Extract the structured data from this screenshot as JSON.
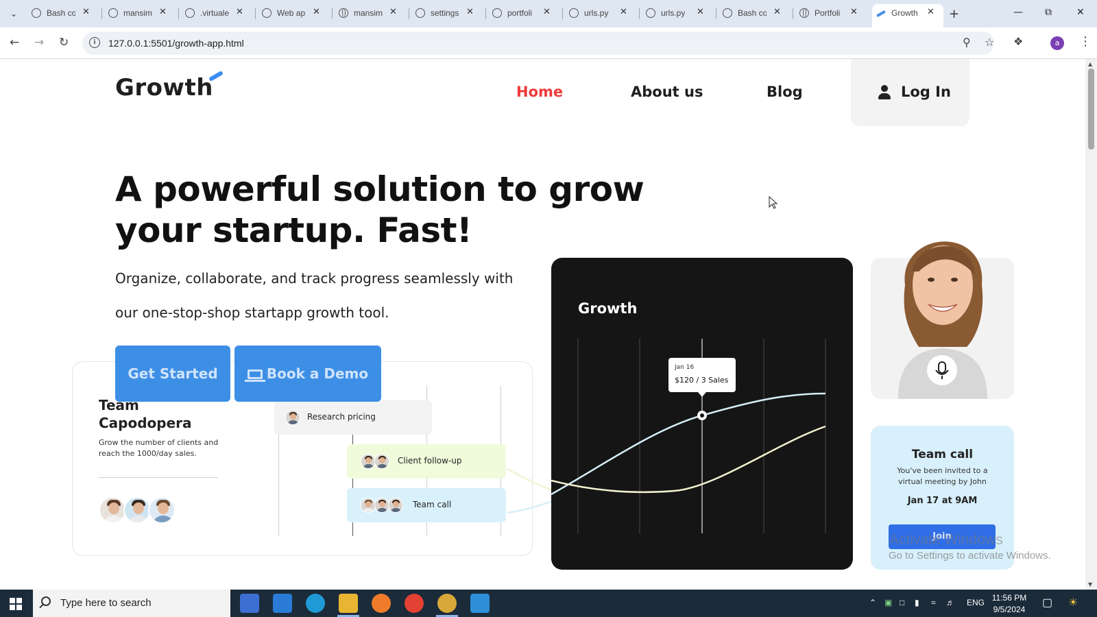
{
  "browser": {
    "tabs": [
      {
        "label": "Bash co",
        "icon": "loading-icon"
      },
      {
        "label": "mansim",
        "icon": "loading-icon"
      },
      {
        "label": ".virtuale",
        "icon": "loading-icon"
      },
      {
        "label": "Web ap",
        "icon": "loading-icon"
      },
      {
        "label": "mansim",
        "icon": "globe-icon"
      },
      {
        "label": "settings",
        "icon": "loading-icon"
      },
      {
        "label": "portfoli",
        "icon": "loading-icon"
      },
      {
        "label": "urls.py",
        "icon": "loading-icon"
      },
      {
        "label": "urls.py",
        "icon": "loading-icon"
      },
      {
        "label": "Bash co",
        "icon": "loading-icon"
      },
      {
        "label": "Portfoli",
        "icon": "globe-icon"
      },
      {
        "label": "Growth",
        "icon": "growth-favicon",
        "active": true
      }
    ],
    "url": "127.0.0.1:5501/growth-app.html",
    "profile_initial": "a"
  },
  "site": {
    "logo": "Growth",
    "nav": {
      "home": "Home",
      "about": "About us",
      "blog": "Blog",
      "login": "Log In"
    },
    "hero": {
      "title": "A powerful solution to grow your startup. Fast!",
      "subtitle": "Organize, collaborate, and track progress seamlessly with our one-stop-shop startapp growth tool.",
      "cta_primary": "Get Started",
      "cta_secondary": "Book a Demo"
    },
    "team_card": {
      "title": "Team Capodopera",
      "description": "Grow the number of clients and reach the 1000/day sales.",
      "tasks": [
        "Research pricing",
        "Client follow-up",
        "Team call"
      ]
    },
    "growth_card": {
      "title": "Growth",
      "tooltip_date": "Jan 16",
      "tooltip_value": "$120 / 3 Sales"
    },
    "call_card": {
      "title": "Team call",
      "subtitle": "You've been invited to a virtual meeting by John",
      "date": "Jan 17 at 9AM",
      "join": "Join"
    }
  },
  "watermark": {
    "line1": "Activate Windows",
    "line2": "Go to Settings to activate Windows."
  },
  "taskbar": {
    "search_placeholder": "Type here to search",
    "language": "ENG",
    "time": "11:56 PM",
    "date": "9/5/2024"
  },
  "colors": {
    "accent": "#3d8fe6",
    "nav_active": "#ef3b3b",
    "chart_bg": "#151515",
    "call_bg": "#d8f0fb"
  }
}
